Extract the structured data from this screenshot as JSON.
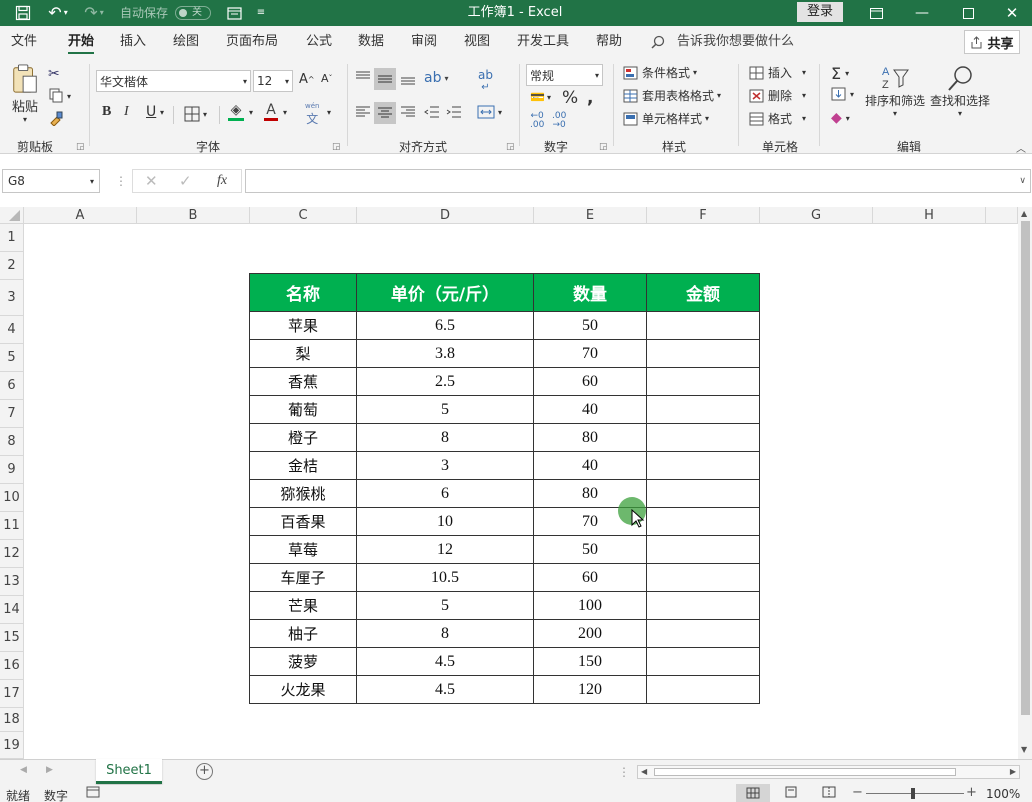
{
  "titlebar": {
    "autosave_label": "自动保存",
    "autosave_state": "关",
    "title": "工作簿1  -  Excel",
    "login": "登录"
  },
  "tabs": [
    "文件",
    "开始",
    "插入",
    "绘图",
    "页面布局",
    "公式",
    "数据",
    "审阅",
    "视图",
    "开发工具",
    "帮助"
  ],
  "active_tab": "开始",
  "tell_me": "告诉我你想要做什么",
  "share": "共享",
  "ribbon": {
    "paste": "粘贴",
    "clipboard": "剪贴板",
    "font_name": "华文楷体",
    "font_size": "12",
    "font_group": "字体",
    "bold": "B",
    "italic": "I",
    "underline": "U",
    "align_group": "对齐方式",
    "number_format": "常规",
    "number_group": "数字",
    "cond_format": "条件格式",
    "table_format": "套用表格格式",
    "cell_style": "单元格样式",
    "style_group": "样式",
    "insert": "插入",
    "delete": "删除",
    "format": "格式",
    "cells_group": "单元格",
    "sort_filter": "排序和筛选",
    "find_select": "查找和选择",
    "edit_group": "编辑"
  },
  "formula_bar": {
    "name_box": "G8",
    "formula": "",
    "fx": "fx"
  },
  "columns": [
    "A",
    "B",
    "C",
    "D",
    "E",
    "F",
    "G",
    "H"
  ],
  "rows": [
    "1",
    "2",
    "3",
    "4",
    "5",
    "6",
    "7",
    "8",
    "9",
    "10",
    "11",
    "12",
    "13",
    "14",
    "15",
    "16",
    "17",
    "18",
    "19"
  ],
  "table": {
    "headers": [
      "名称",
      "单价（元/斤）",
      "数量",
      "金额"
    ],
    "rows": [
      [
        "苹果",
        "6.5",
        "50",
        ""
      ],
      [
        "梨",
        "3.8",
        "70",
        ""
      ],
      [
        "香蕉",
        "2.5",
        "60",
        ""
      ],
      [
        "葡萄",
        "5",
        "40",
        ""
      ],
      [
        "橙子",
        "8",
        "80",
        ""
      ],
      [
        "金桔",
        "3",
        "40",
        ""
      ],
      [
        "猕猴桃",
        "6",
        "80",
        ""
      ],
      [
        "百香果",
        "10",
        "70",
        ""
      ],
      [
        "草莓",
        "12",
        "50",
        ""
      ],
      [
        "车厘子",
        "10.5",
        "60",
        ""
      ],
      [
        "芒果",
        "5",
        "100",
        ""
      ],
      [
        "柚子",
        "8",
        "200",
        ""
      ],
      [
        "菠萝",
        "4.5",
        "150",
        ""
      ],
      [
        "火龙果",
        "4.5",
        "120",
        ""
      ]
    ]
  },
  "sheet_tab": "Sheet1",
  "status": {
    "ready": "就绪",
    "num": "数字",
    "zoom": "100%"
  },
  "colors": {
    "excel_green": "#217346",
    "header_fill": "#00b050"
  }
}
